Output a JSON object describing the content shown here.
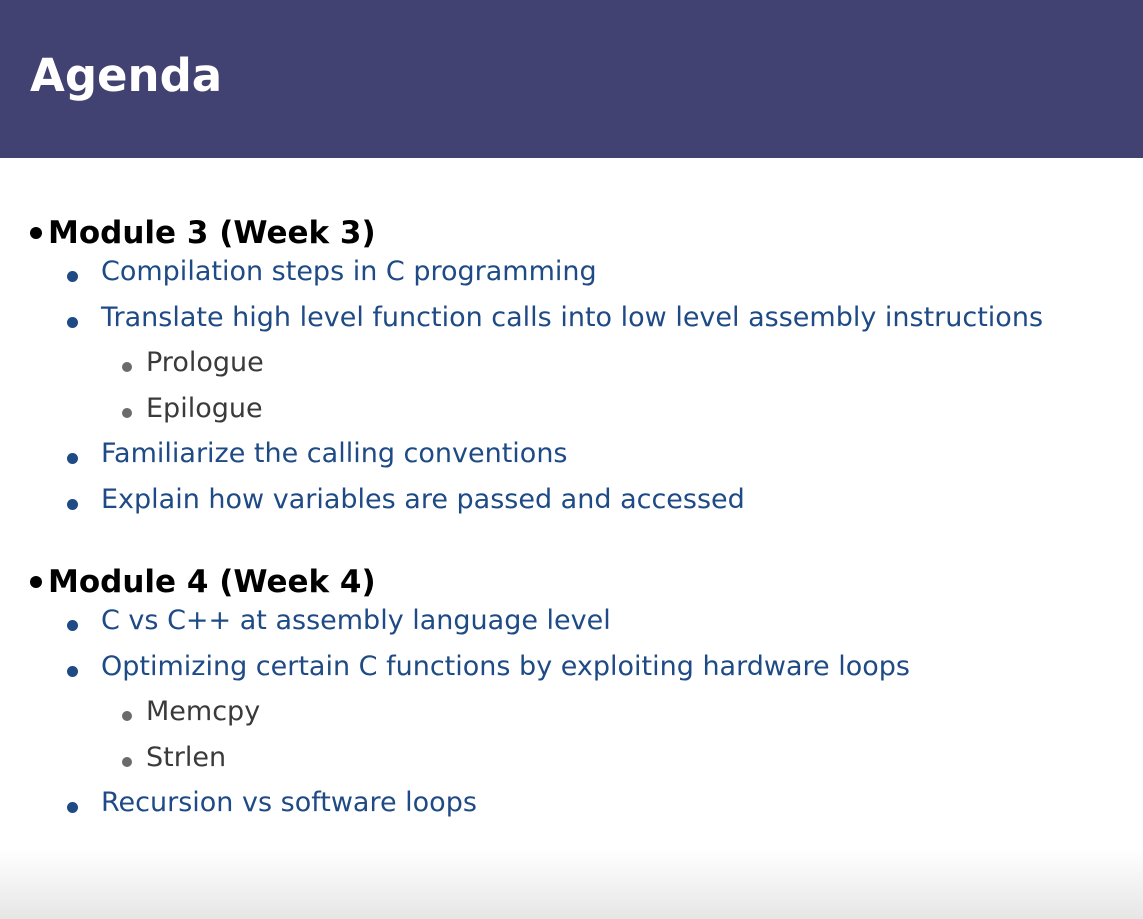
{
  "slide": {
    "title": "Agenda",
    "modules": [
      {
        "heading": "Module 3 (Week 3)",
        "items": [
          {
            "text": "Compilation steps in C programming",
            "level": 1
          },
          {
            "text": "Translate high level function calls into low level assembly instructions",
            "level": 1
          },
          {
            "text": "Prologue",
            "level": 2
          },
          {
            "text": "Epilogue",
            "level": 2
          },
          {
            "text": "Familiarize the calling conventions",
            "level": 1
          },
          {
            "text": "Explain how variables are passed and accessed",
            "level": 1
          }
        ]
      },
      {
        "heading": "Module 4 (Week 4)",
        "items": [
          {
            "text": "C vs C++ at assembly language level",
            "level": 1
          },
          {
            "text": "Optimizing certain C functions by exploiting hardware loops",
            "level": 1
          },
          {
            "text": "Memcpy",
            "level": 2
          },
          {
            "text": "Strlen",
            "level": 2
          },
          {
            "text": "Recursion vs software loops",
            "level": 1
          }
        ]
      }
    ]
  },
  "colors": {
    "title_bar": "#414272",
    "title_text": "#ffffff",
    "heading_text": "#000000",
    "level1_text": "#1e4a85",
    "level2_text": "#3a3a3a",
    "level2_bullet": "#6b6b6b"
  }
}
